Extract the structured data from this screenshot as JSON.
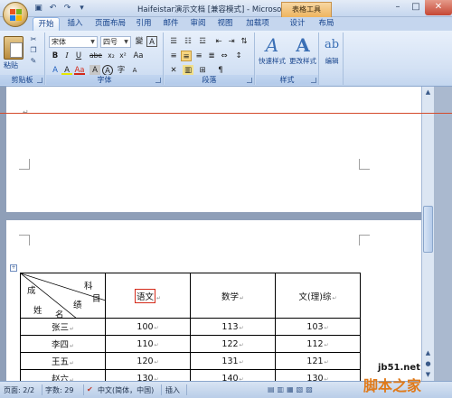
{
  "window": {
    "title": "Haifeistar演示文档 [兼容模式] - Microsoft Word",
    "context_tab": "表格工具",
    "controls": [
      "–",
      "□",
      "✕"
    ]
  },
  "tabs": [
    "开始",
    "插入",
    "页面布局",
    "引用",
    "邮件",
    "审阅",
    "视图",
    "加载项",
    "设计",
    "布局"
  ],
  "ribbon": {
    "clipboard": {
      "paste_label": "粘贴",
      "group_label": "剪贴板"
    },
    "font": {
      "font_name": "宋体",
      "font_size": "四号",
      "group_label": "字体",
      "buttons_row1": [
        "變",
        "A"
      ],
      "buttons_row2": [
        "B",
        "I",
        "U",
        "abe",
        "x₂",
        "x²",
        "Aa"
      ],
      "buttons_row3": [
        "A",
        "A",
        "Aa",
        "A",
        "A",
        "字",
        "A"
      ]
    },
    "paragraph": {
      "group_label": "段落"
    },
    "styles": {
      "group_label": "样式",
      "quick_styles": "快速样式",
      "change_styles": "更改样式"
    },
    "editing": {
      "label": "编辑"
    }
  },
  "document": {
    "table": {
      "header": {
        "diag_top": "科",
        "diag_top2": "目",
        "diag_mid1": "成",
        "diag_mid2": "绩",
        "diag_bot1": "姓",
        "diag_bot2": "名"
      },
      "columns": [
        "语文",
        "数学",
        "文(理)综"
      ],
      "rows": [
        {
          "name": "张三",
          "scores": [
            "100",
            "113",
            "103"
          ]
        },
        {
          "name": "李四",
          "scores": [
            "110",
            "122",
            "112"
          ]
        },
        {
          "name": "王五",
          "scores": [
            "120",
            "131",
            "121"
          ]
        },
        {
          "name": "赵六",
          "scores": [
            "130",
            "140",
            "130"
          ]
        }
      ]
    }
  },
  "statusbar": {
    "page": "页面: 2/2",
    "words": "字数: 29",
    "language": "中文(简体，中国)",
    "mode": "插入"
  },
  "watermark": {
    "domain": "jb51.net",
    "name": "脚本之家"
  }
}
